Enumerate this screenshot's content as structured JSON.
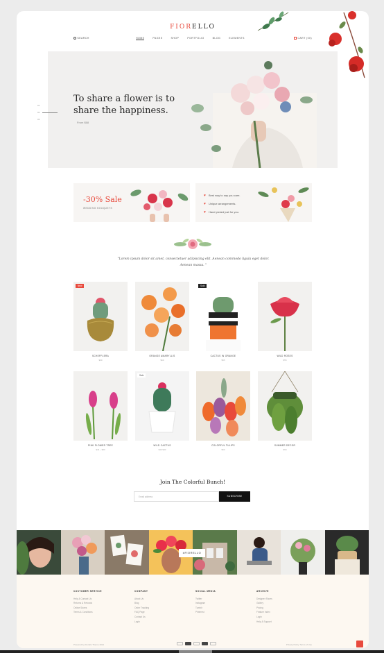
{
  "brand": {
    "logo_a": "FIOR",
    "logo_b": "ELLO"
  },
  "nav": {
    "search": "SEARCH",
    "items": [
      "HOME",
      "PAGES",
      "SHOP",
      "PORTFOLIO",
      "BLOG",
      "ELEMENTS"
    ],
    "cart": "CART (00)"
  },
  "hero": {
    "title": "To share a flower is to share the happiness.",
    "price": "From $68"
  },
  "side_pager": {
    "items": [
      "01",
      "02",
      "03"
    ]
  },
  "banners": {
    "sale": "-30% Sale",
    "sale_sub": "WEDDING BOUQUETS",
    "list": [
      "Best way to say you care.",
      "Unique arrangements.",
      "Hand picked just for you."
    ]
  },
  "quote": "\"Lorem ipsum dolor sit amet, consectetuer adipiscing elit. Aenean commodo ligula eget dolor. Aenean massa. \"",
  "products": [
    {
      "name": "SCHEFFLERA",
      "price": "$69",
      "badge": "New"
    },
    {
      "name": "ORANGE AMARYLLIS",
      "price": "$69",
      "badge": ""
    },
    {
      "name": "CACTUS IN ORANGE",
      "price": "$55",
      "badge": "Sold"
    },
    {
      "name": "WILD ROSES",
      "price": "$55",
      "badge": ""
    },
    {
      "name": "PINK FLOWER TREE",
      "price": "$44 – $59",
      "badge": ""
    },
    {
      "name": "WILD CACTUS",
      "price": "$40 $30",
      "badge": "Sale"
    },
    {
      "name": "COLORFUL TULIPS",
      "price": "$50",
      "badge": ""
    },
    {
      "name": "SUMMER DECOR",
      "price": "$69",
      "badge": ""
    }
  ],
  "newsletter": {
    "title": "Join The Colorful Bunch!",
    "placeholder": "Email address",
    "button": "SUBSCRIBE"
  },
  "instagram": {
    "tag": "#FIORELLO"
  },
  "footer": {
    "cols": [
      {
        "title": "CUSTOMER SERVICE",
        "links": [
          "Help & Contact Us",
          "Returns & Refunds",
          "Online Stores",
          "Terms & Conditions"
        ]
      },
      {
        "title": "COMPANY",
        "links": [
          "About Us",
          "Blog",
          "Order Tracking",
          "FAQ Page",
          "Contact Us",
          "Login"
        ]
      },
      {
        "title": "SOCIAL MEDIA",
        "links": [
          "Twitter",
          "Instagram",
          "Tumblr",
          "Pinterest"
        ]
      },
      {
        "title": "ARCHIVE",
        "links": [
          "Designer Shoes",
          "Gallery",
          "Pricing",
          "Feature Index",
          "Login",
          "Help & Support"
        ]
      }
    ],
    "copyright": "Powered by Fiorello Theme 2021",
    "links": "Privacy Policy   Terms of Use"
  },
  "colors": {
    "accent": "#e84a3d",
    "dark": "#111111",
    "footer_bg": "#fdf8f1"
  }
}
